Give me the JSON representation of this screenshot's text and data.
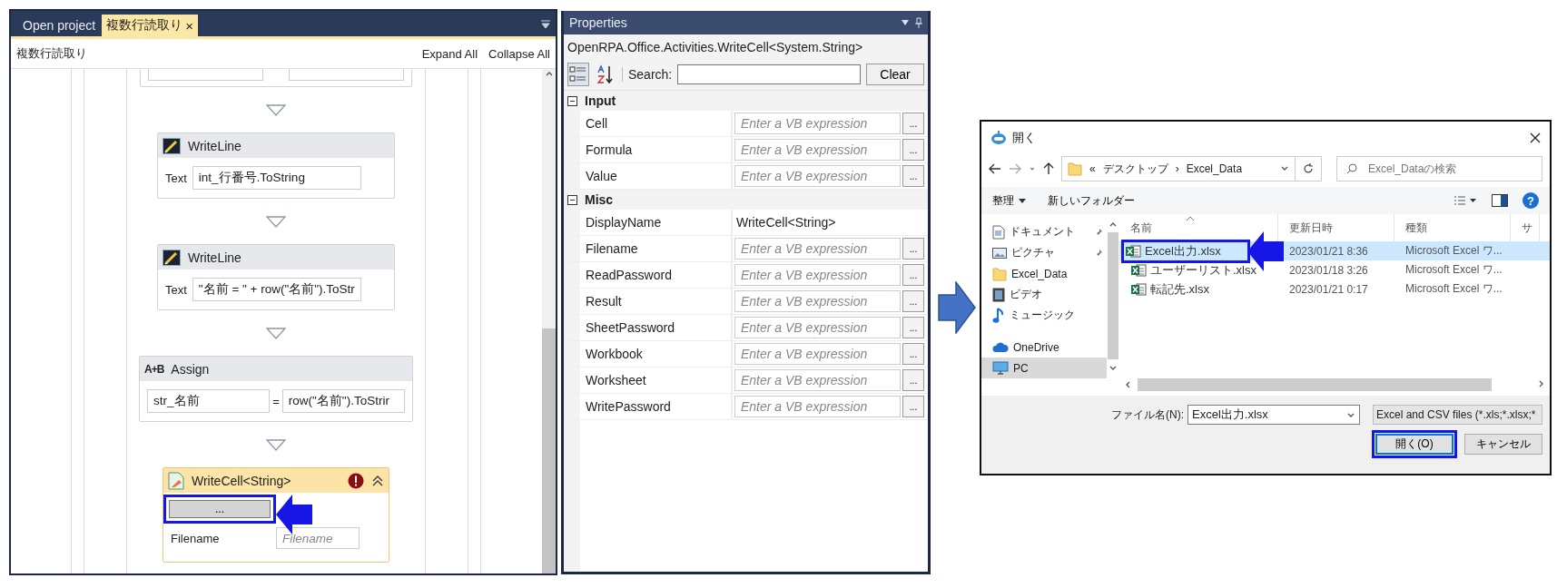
{
  "designer": {
    "tabs": [
      {
        "label": "Open project",
        "selected": false
      },
      {
        "label": "複数行読取り",
        "selected": true,
        "close": "×"
      }
    ],
    "breadcrumb": "複数行読取り",
    "expand_all": "Expand All",
    "collapse_all": "Collapse All",
    "activities": [
      {
        "kind": "cut-off"
      },
      {
        "kind": "writeline",
        "title": "WriteLine",
        "field_label": "Text",
        "value": "int_行番号.ToString"
      },
      {
        "kind": "writeline",
        "title": "WriteLine",
        "field_label": "Text",
        "value": "\"名前 = \" + row(\"名前\").ToStr"
      },
      {
        "kind": "assign",
        "title": "Assign",
        "icon_label": "A+B",
        "target": "str_名前",
        "operator": "=",
        "value": "row(\"名前\").ToStrir"
      },
      {
        "kind": "writecell",
        "title": "WriteCell<String>",
        "error": true,
        "button": "...",
        "highlighted": true,
        "field_label": "Filename",
        "placeholder": "Filename"
      }
    ]
  },
  "properties": {
    "title": "Properties",
    "type_name": "OpenRPA.Office.Activities.WriteCell<System.String>",
    "categorized": true,
    "search_label": "Search:",
    "clear": "Clear",
    "categories": [
      {
        "name": "Input",
        "expanded": true,
        "rows": [
          {
            "kind": "expression",
            "name": "Cell",
            "placeholder": "Enter a VB expression",
            "browse": "..."
          },
          {
            "kind": "expression",
            "name": "Formula",
            "placeholder": "Enter a VB expression",
            "browse": "..."
          },
          {
            "kind": "expression",
            "name": "Value",
            "placeholder": "Enter a VB expression",
            "browse": "..."
          }
        ]
      },
      {
        "name": "Misc",
        "expanded": true,
        "rows": [
          {
            "kind": "text",
            "name": "DisplayName",
            "value": "WriteCell<String>"
          },
          {
            "kind": "expression",
            "name": "Filename",
            "placeholder": "Enter a VB expression",
            "browse": "..."
          },
          {
            "kind": "expression",
            "name": "ReadPassword",
            "placeholder": "Enter a VB expression",
            "browse": "..."
          },
          {
            "kind": "expression",
            "name": "Result",
            "placeholder": "Enter a VB expression",
            "browse": "..."
          },
          {
            "kind": "expression",
            "name": "SheetPassword",
            "placeholder": "Enter a VB expression",
            "browse": "..."
          },
          {
            "kind": "expression",
            "name": "Workbook",
            "placeholder": "Enter a VB expression",
            "browse": "..."
          },
          {
            "kind": "expression",
            "name": "Worksheet",
            "placeholder": "Enter a VB expression",
            "browse": "..."
          },
          {
            "kind": "expression",
            "name": "WritePassword",
            "placeholder": "Enter a VB expression",
            "browse": "..."
          }
        ]
      }
    ]
  },
  "dialog": {
    "title": "開く",
    "address": {
      "overflow": "«",
      "crumbs": [
        "デスクトップ",
        "Excel_Data"
      ],
      "separator": "›"
    },
    "search_placeholder": "Excel_Dataの検索",
    "organize": "整理",
    "new_folder": "新しいフォルダー",
    "help": "?",
    "nav": [
      {
        "kind": "document",
        "label": "ドキュメント",
        "pinned": true,
        "selected": false
      },
      {
        "kind": "picture",
        "label": "ピクチャ",
        "pinned": true,
        "selected": false
      },
      {
        "kind": "folder",
        "label": "Excel_Data",
        "pinned": false,
        "selected": false
      },
      {
        "kind": "video",
        "label": "ビデオ",
        "pinned": false,
        "selected": false
      },
      {
        "kind": "music",
        "label": "ミュージック",
        "pinned": false,
        "selected": false
      },
      {
        "kind": "cloud",
        "label": "OneDrive",
        "pinned": false,
        "selected": false
      },
      {
        "kind": "pc",
        "label": "PC",
        "pinned": false,
        "selected": true
      }
    ],
    "columns": [
      "名前",
      "更新日時",
      "種類",
      "サ"
    ],
    "files": [
      {
        "name": "Excel出力.xlsx",
        "modified": "2023/01/21 8:36",
        "type": "Microsoft Excel ワ...",
        "selected": true,
        "highlighted": true
      },
      {
        "name": "ユーザーリスト.xlsx",
        "modified": "2023/01/18 3:26",
        "type": "Microsoft Excel ワ...",
        "selected": false,
        "highlighted": false
      },
      {
        "name": "転記先.xlsx",
        "modified": "2023/01/21 0:17",
        "type": "Microsoft Excel ワ...",
        "selected": false,
        "highlighted": false
      }
    ],
    "file_name_label": "ファイル名(N):",
    "file_name": "Excel出力.xlsx",
    "filter": "Excel and CSV files (*.xls;*.xlsx;*",
    "buttons": [
      {
        "label": "開く(O)",
        "highlighted": true
      },
      {
        "label": "キャンセル",
        "highlighted": false
      }
    ]
  }
}
